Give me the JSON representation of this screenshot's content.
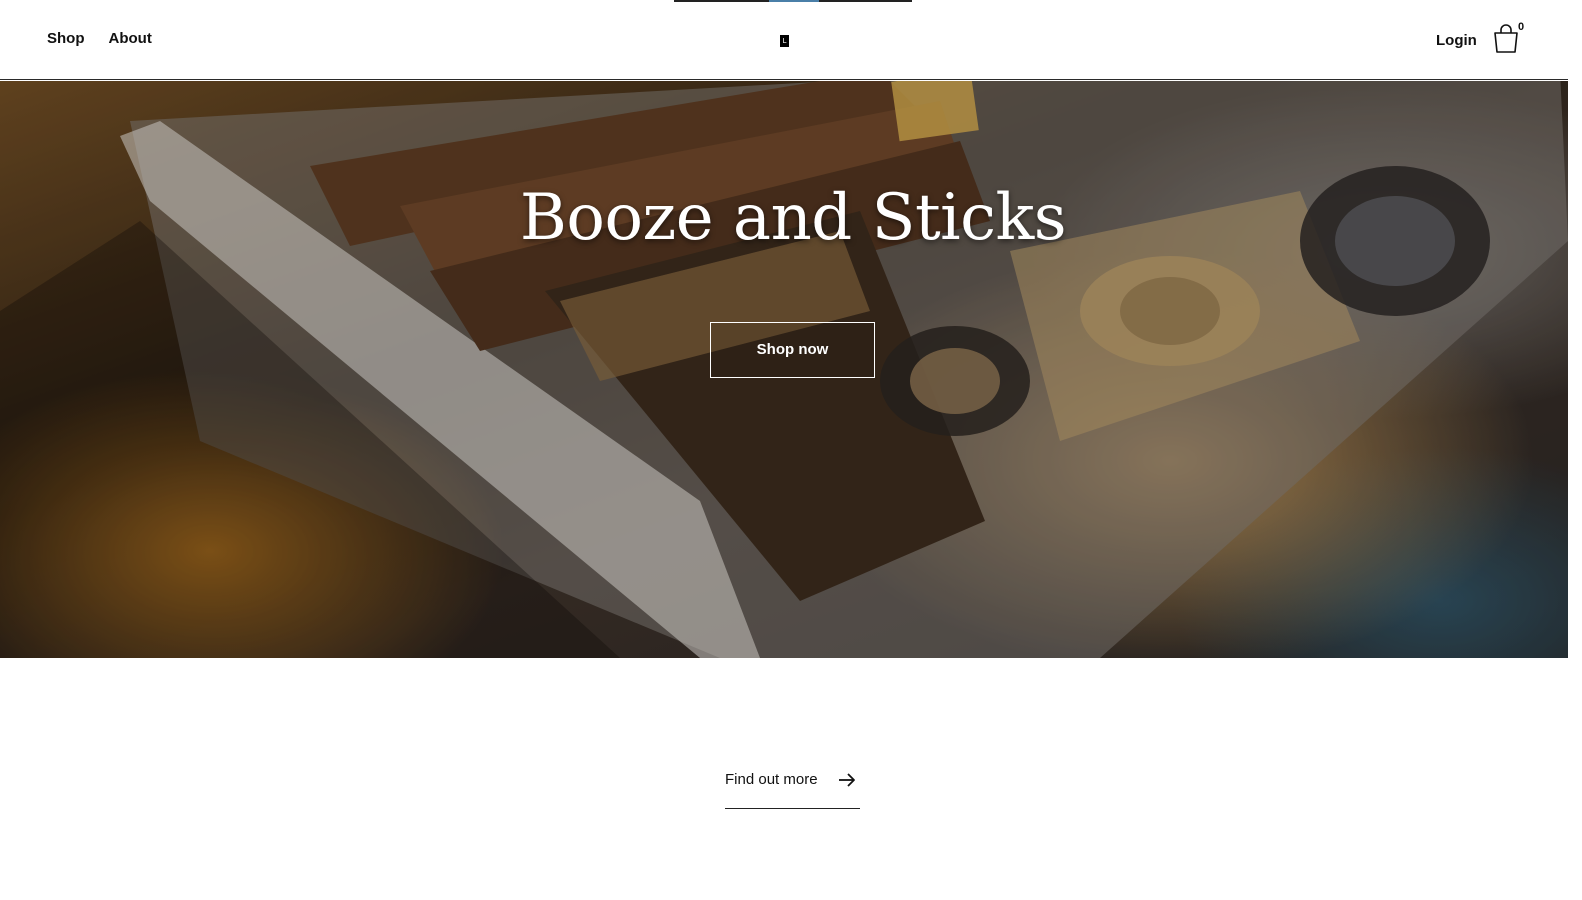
{
  "header": {
    "nav": [
      {
        "label": "Shop"
      },
      {
        "label": "About"
      }
    ],
    "logo_text": "L",
    "login_label": "Login",
    "cart_count": "0",
    "cart_icon": "shopping-bag-icon"
  },
  "hero": {
    "title": "Booze and Sticks",
    "button_label": "Shop now",
    "image_subject": "cigars, lighter and cigar cutter on an ashtray"
  },
  "find_more": {
    "label": "Find out more",
    "icon": "arrow-right-icon"
  },
  "colors": {
    "text": "#111111",
    "background": "#ffffff",
    "hero_text": "#ffffff"
  }
}
